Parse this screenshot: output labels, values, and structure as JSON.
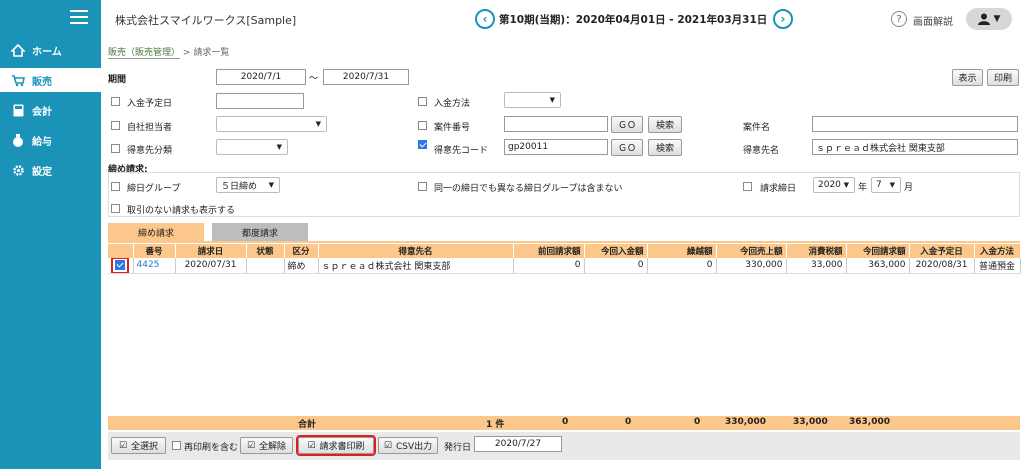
{
  "sidebar": {
    "items": [
      {
        "label": "ホーム"
      },
      {
        "label": "販売"
      },
      {
        "label": "会計"
      },
      {
        "label": "給与"
      },
      {
        "label": "設定"
      }
    ]
  },
  "header": {
    "company": "株式会社スマイルワークス[Sample]",
    "period": "第10期(当期)：2020年04月01日 - 2021年03月31日",
    "help": "画面解説"
  },
  "breadcrumb": {
    "link": "販売（販売管理）",
    "sep": ">",
    "current": "請求一覧"
  },
  "search": {
    "period_label": "期間",
    "period_from": "2020/7/1",
    "period_tilde": "〜",
    "period_to": "2020/7/31",
    "show_btn": "表示",
    "print_btn": "印刷",
    "due_date_label": "入金予定日",
    "payment_method_label": "入金方法",
    "staff_label": "自社担当者",
    "case_no_label": "案件番号",
    "case_name_label": "案件名",
    "cust_class_label": "得意先分類",
    "cust_code_label": "得意先コード",
    "cust_code_value": "gp20011",
    "cust_name_label": "得意先名",
    "cust_name_value": "ｓｐｒｅａｄ株式会社 関東支部",
    "go": "ＧＯ",
    "search_btn": "検索",
    "closing_title": "締め請求:",
    "closing_group_label": "締日グループ",
    "closing_group_value": "５日締め",
    "same_day_label": "同一の締日でも異なる締日グループは含まない",
    "bill_closing_label": "請求締日",
    "year_value": "2020",
    "year_unit": "年",
    "month_value": "7",
    "month_unit": "月",
    "no_trans_label": "取引のない請求も表示する"
  },
  "tabs": [
    {
      "label": "締め請求"
    },
    {
      "label": "都度請求"
    }
  ],
  "table": {
    "headers": [
      "番号",
      "請求日",
      "状態",
      "区分",
      "得意先名",
      "前回請求額",
      "今回入金額",
      "繰越額",
      "今回売上額",
      "消費税額",
      "今回請求額",
      "入金予定日",
      "入金方法"
    ],
    "rows": [
      {
        "no": "4425",
        "date": "2020/07/31",
        "status": "",
        "kubun": "締め",
        "customer": "ｓｐｒｅａｄ株式会社 関東支部",
        "prev": "0",
        "paid": "0",
        "carry": "0",
        "sales": "330,000",
        "tax": "33,000",
        "bill": "363,000",
        "due": "2020/08/31",
        "method": "普通預金"
      }
    ]
  },
  "totals": {
    "label": "合計",
    "count": "1 件",
    "prev": "0",
    "paid": "0",
    "carry": "0",
    "sales": "330,000",
    "tax": "33,000",
    "bill": "363,000"
  },
  "footer": {
    "select_all": "全選択",
    "reprint": "再印刷を含む",
    "clear_all": "全解除",
    "print_invoice": "請求書印刷",
    "csv": "CSV出力",
    "issue_date_label": "発行日",
    "issue_date_value": "2020/7/27"
  },
  "colors": {
    "sidebar": "#1b93b9",
    "table_header": "#fbc78a",
    "highlight": "#e02020"
  }
}
